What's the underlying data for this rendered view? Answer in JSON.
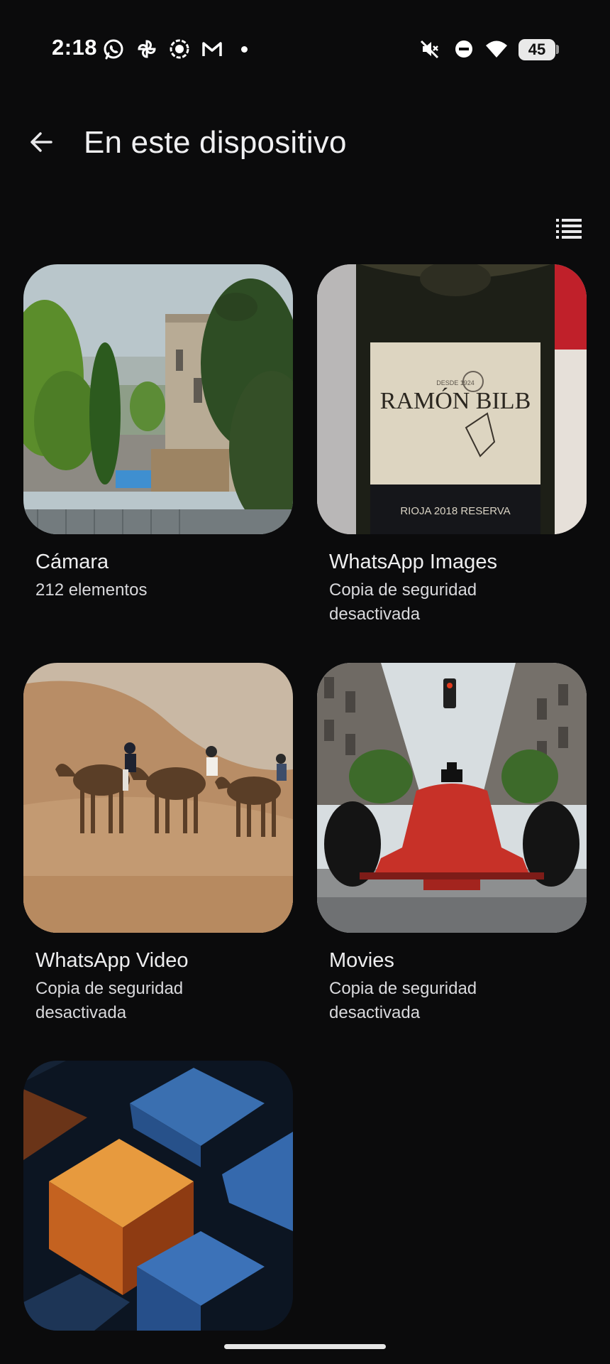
{
  "status_bar": {
    "time": "2:18",
    "battery": "45",
    "notification_icons": [
      "whatsapp-icon",
      "pinwheel-icon",
      "screen-record-icon",
      "gmail-icon"
    ],
    "system_icons": [
      "mute-icon",
      "do-not-disturb-icon",
      "wifi-icon",
      "battery-icon"
    ]
  },
  "header": {
    "title": "En este dispositivo",
    "back_icon": "arrow-left-icon",
    "view_toggle_icon": "list-view-icon"
  },
  "albums": [
    {
      "title": "Cámara",
      "subtitle": "212 elementos"
    },
    {
      "title": "WhatsApp Images",
      "subtitle": "Copia de seguridad desactivada"
    },
    {
      "title": "WhatsApp Video",
      "subtitle": "Copia de seguridad desactivada"
    },
    {
      "title": "Movies",
      "subtitle": "Copia de seguridad desactivada"
    },
    {
      "title": "",
      "subtitle": ""
    }
  ],
  "thumbnail_text": {
    "wine_label": "RAMÓN BILB",
    "wine_small": "DESDE 1924",
    "wine_bottom": "RIOJA  2018  RESERVA"
  }
}
